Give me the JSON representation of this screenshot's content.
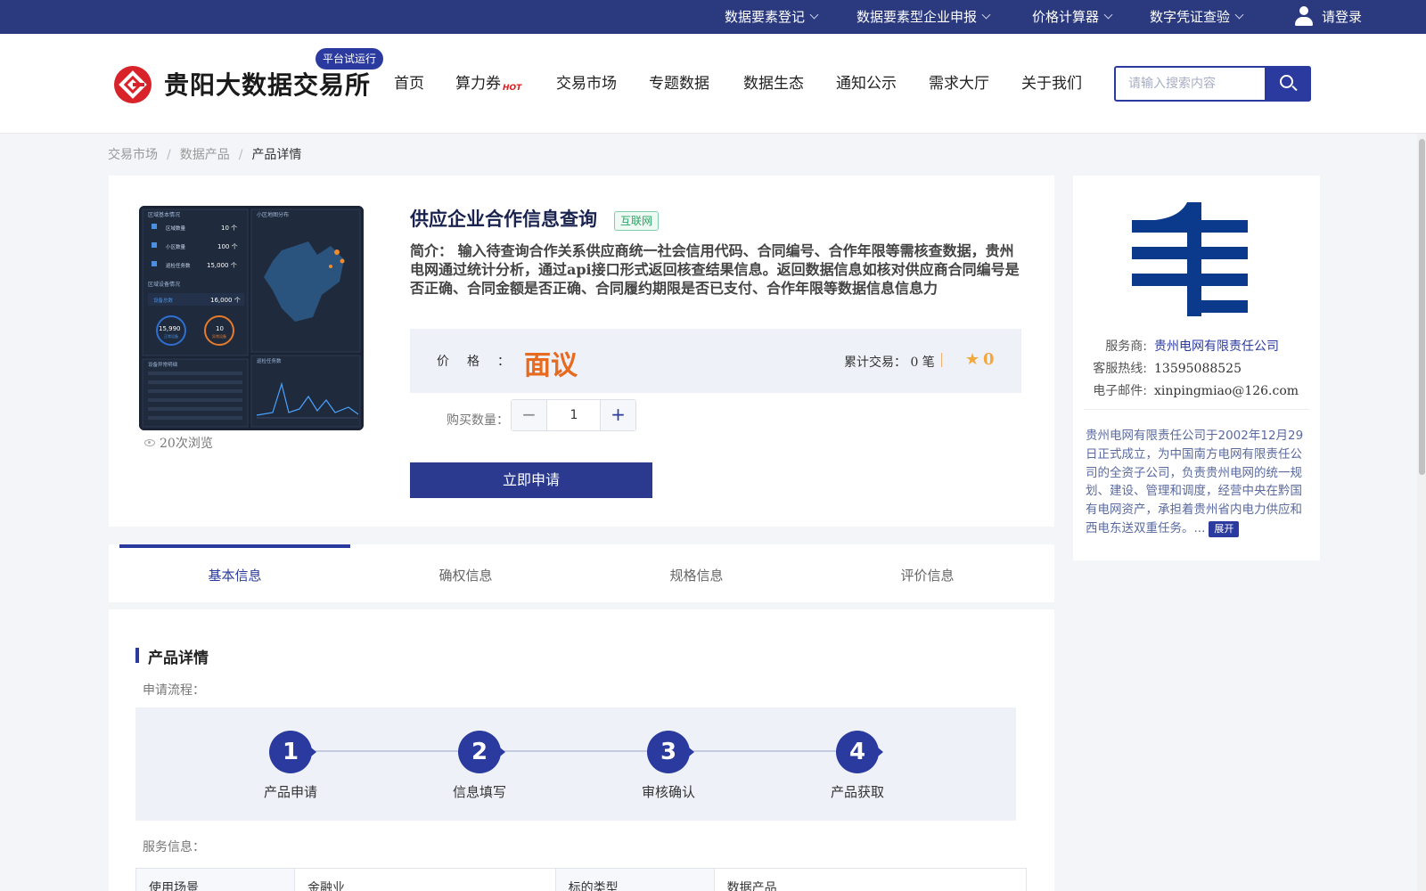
{
  "topbar": {
    "items": [
      "数据要素登记",
      "数据要素型企业申报",
      "价格计算器",
      "数字凭证查验"
    ],
    "login": "请登录"
  },
  "header": {
    "logo_text": "贵阳大数据交易所",
    "beta_badge": "平台试运行",
    "nav": [
      "首页",
      "算力券",
      "交易市场",
      "专题数据",
      "数据生态",
      "通知公示",
      "需求大厅",
      "关于我们"
    ],
    "hot_label": "HOT",
    "search_placeholder": "请输入搜索内容"
  },
  "breadcrumb": [
    "交易市场",
    "数据产品",
    "产品详情"
  ],
  "thumbnail": {
    "panel_left_title": "区域基本情况",
    "panel_map_title": "小区地图分布",
    "rows": [
      {
        "label": "区域数量",
        "value": "10 个"
      },
      {
        "label": "小区数量",
        "value": "100 个"
      },
      {
        "label": "巡检任务数",
        "value": "15,000 个"
      }
    ],
    "device_title": "区域设备情况",
    "device_total_label": "设备总数",
    "device_total": "16,000 个",
    "circles": [
      {
        "value": "15,990",
        "label": "正常设备"
      },
      {
        "value": "10",
        "label": "异常设备"
      }
    ],
    "anomaly_title": "设备异常明细",
    "chart_title": "巡检任务数"
  },
  "product": {
    "title": "供应企业合作信息查询",
    "tag": "互联网",
    "description": "简介： 输入待查询合作关系供应商统一社会信用代码、合同编号、合作年限等需核查数据，贵州电网通过统计分析，通过api接口形式返回核查结果信息。返回数据信息如核对供应商合同编号是否正确、合同金额是否正确、合同履约期限是否已支付、合作年限等数据信息信息力",
    "views": "20次浏览",
    "price_label": "价格：",
    "price_value": "面议",
    "trades": "累计交易： 0 笔",
    "rating": "0",
    "qty_label": "购买数量：",
    "qty_value": "1",
    "apply_label": "立即申请"
  },
  "provider": {
    "rows": [
      {
        "key": "服务商:",
        "value": "贵州电网有限责任公司"
      },
      {
        "key": "客服热线:",
        "value": "13595088525"
      },
      {
        "key": "电子邮件:",
        "value": "xinpingmiao@126.com"
      }
    ],
    "description": "贵州电网有限责任公司于2002年12月29日正式成立，为中国南方电网有限责任公司的全资子公司，负责贵州电网的统一规划、建设、管理和调度，经营中央在黔国有电网资产，承担着贵州省内电力供应和西电东送双重任务。...",
    "expand_label": "展开"
  },
  "tabs": [
    "基本信息",
    "确权信息",
    "规格信息",
    "评价信息"
  ],
  "detail": {
    "section_title": "产品详情",
    "flow_label": "申请流程：",
    "steps": [
      {
        "num": "1",
        "label": "产品申请"
      },
      {
        "num": "2",
        "label": "信息填写"
      },
      {
        "num": "3",
        "label": "审核确认"
      },
      {
        "num": "4",
        "label": "产品获取"
      }
    ],
    "service_label": "服务信息：",
    "table": [
      [
        "使用场景",
        "金融业",
        "标的类型",
        "数据产品"
      ]
    ]
  },
  "colors": {
    "brand": "#2b3a9f",
    "topbar": "#2b3a7f",
    "price": "#e76a1f",
    "logo_red": "#d9232a",
    "provider_blue": "#0b3a8c"
  }
}
